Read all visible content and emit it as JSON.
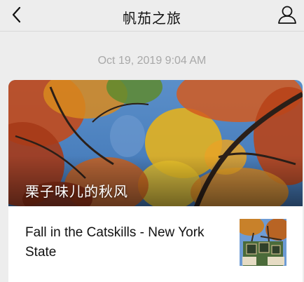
{
  "header": {
    "title": "帆茄之旅",
    "back_icon": "chevron-left-icon",
    "profile_icon": "person-icon"
  },
  "timestamp": "Oct 19, 2019 9:04 AM",
  "article": {
    "cover_title": "栗子味儿的秋风",
    "items": [
      {
        "title": "Fall in the Catskills -  New York State"
      }
    ]
  },
  "colors": {
    "background": "#ededed",
    "card": "#ffffff",
    "timestamp": "#a8a8a8"
  }
}
